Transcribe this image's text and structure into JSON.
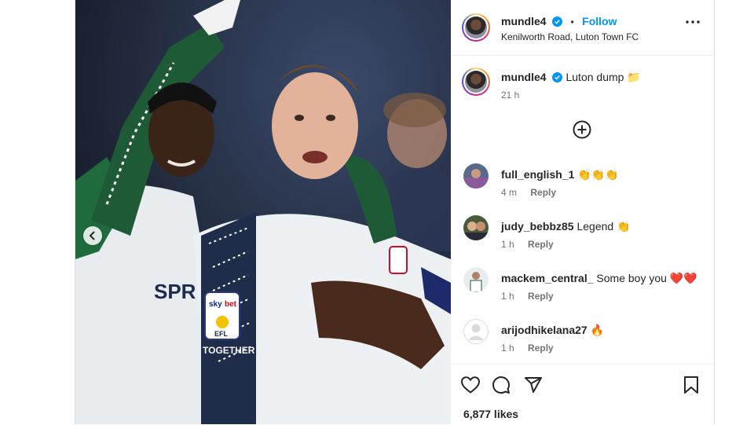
{
  "post": {
    "media": {
      "description_icon": "photo",
      "prev_button_icon": "chevron-left-icon"
    },
    "header": {
      "username": "mundle4",
      "separator": "•",
      "follow_label": "Follow",
      "location": "Kenilworth Road, Luton Town FC"
    },
    "caption": {
      "username": "mundle4",
      "text": "Luton dump 📁",
      "time": "21 h"
    },
    "comments": [
      {
        "username": "full_english_1",
        "text": "👏👏👏",
        "time": "4 m",
        "reply": "Reply"
      },
      {
        "username": "judy_bebbz85",
        "text": "Legend 👏",
        "time": "1 h",
        "reply": "Reply"
      },
      {
        "username": "mackem_central_",
        "text": "Some boy you ❤️❤️",
        "time": "1 h",
        "reply": "Reply"
      },
      {
        "username": "arijodhikelana27",
        "text": "🔥",
        "time": "1 h",
        "reply": "Reply"
      }
    ],
    "actions": {
      "like_icon": "heart-icon",
      "comment_icon": "comment-icon",
      "share_icon": "share-icon",
      "save_icon": "bookmark-icon"
    },
    "likes": "6,877 likes"
  },
  "colors": {
    "link": "#0095f6",
    "verified": "#0095f6",
    "secondary_text": "#737373",
    "divider": "#efefef"
  }
}
